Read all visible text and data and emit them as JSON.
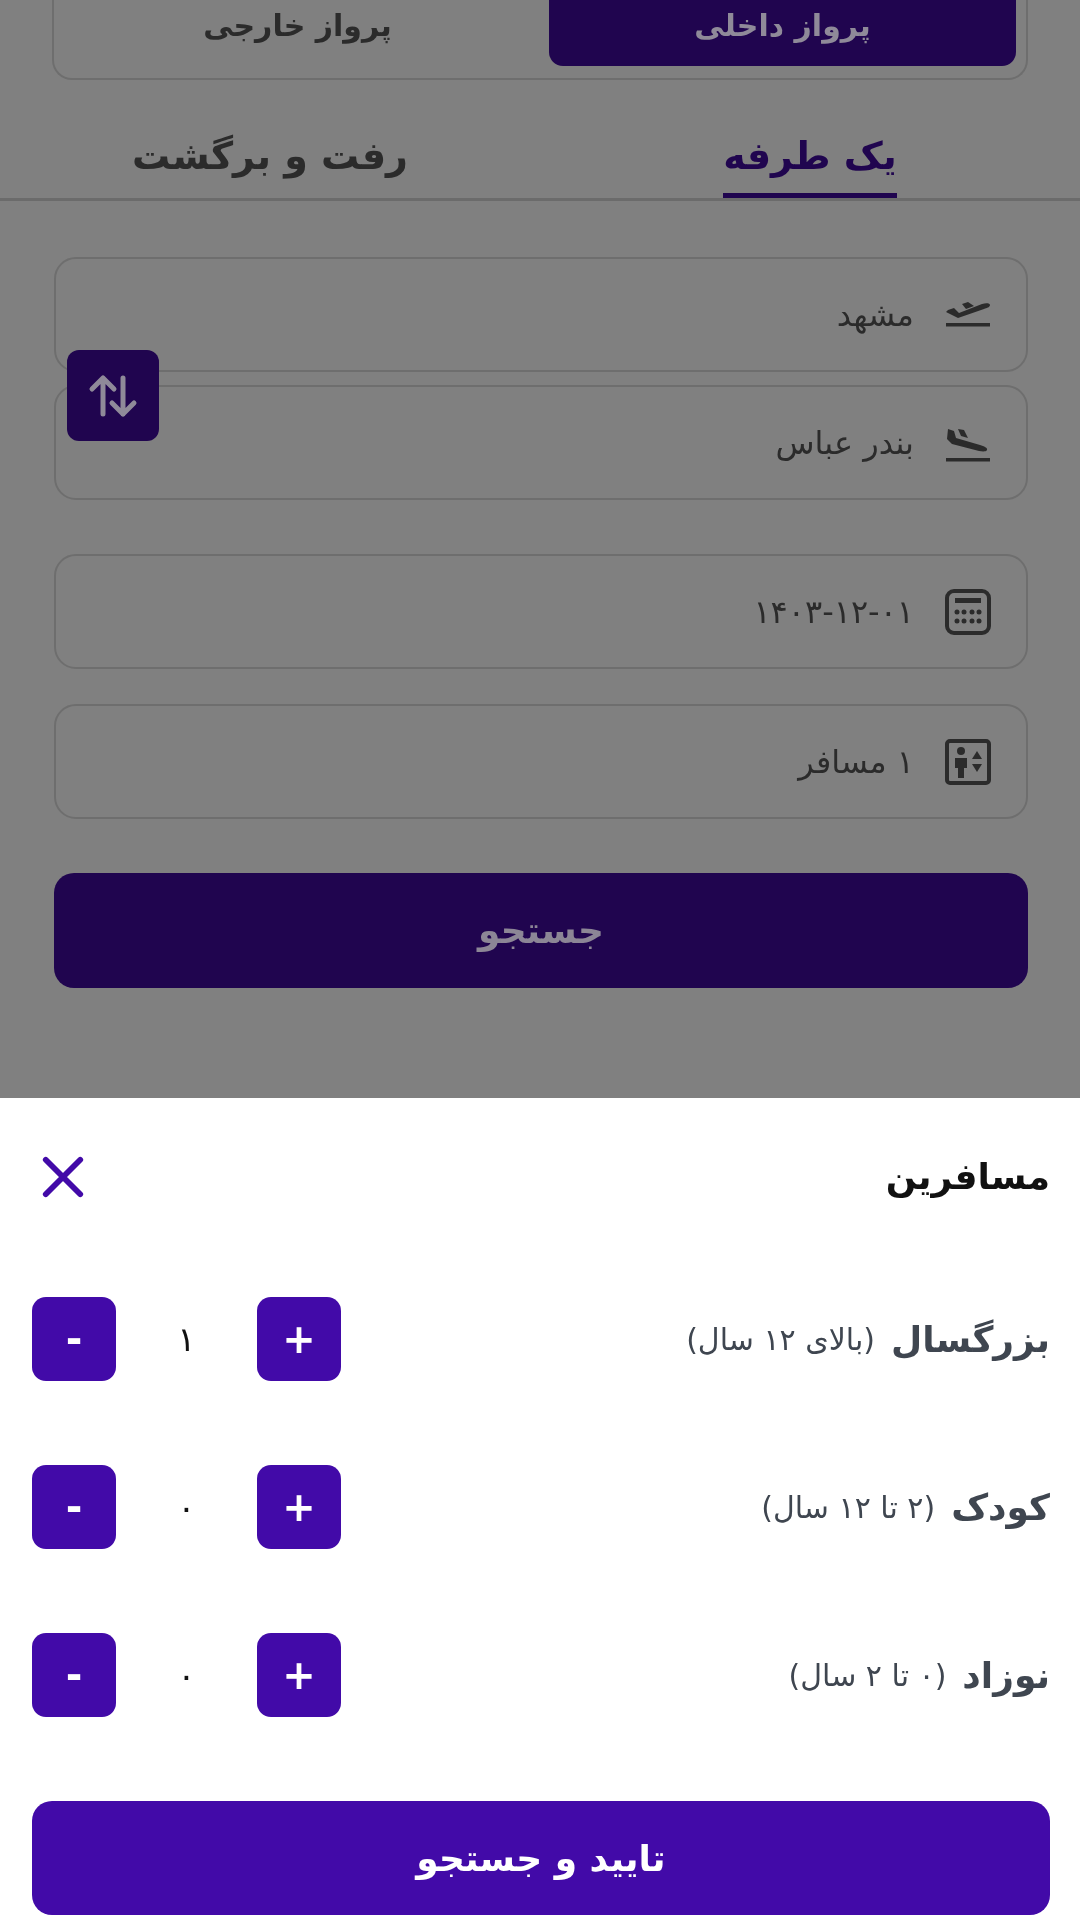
{
  "trip_scope": [
    {
      "label": "پرواز داخلی",
      "selected": true
    },
    {
      "label": "پرواز خارجی",
      "selected": false
    }
  ],
  "trip_type_tabs": [
    {
      "label": "یک طرفه",
      "selected": true
    },
    {
      "label": "رفت و برگشت",
      "selected": false
    }
  ],
  "route": {
    "origin": "مشهد",
    "destination": "بندر عباس"
  },
  "date": "۱۴۰۳-۱۲-۰۱",
  "passengers_field": "۱ مسافر",
  "search_button": "جستجو",
  "sheet": {
    "title": "مسافرین",
    "rows": [
      {
        "label": "بزرگسال",
        "age_range": "(بالای ۱۲ سال)",
        "count": "۱",
        "plus": "+",
        "minus": "-"
      },
      {
        "label": "کودک",
        "age_range": "(۲ تا ۱۲ سال)",
        "count": "۰",
        "plus": "+",
        "minus": "-"
      },
      {
        "label": "نوزاد",
        "age_range": "(۰ تا ۲ سال)",
        "count": "۰",
        "plus": "+",
        "minus": "-"
      }
    ],
    "confirm_button": "تایید و جستجو"
  }
}
